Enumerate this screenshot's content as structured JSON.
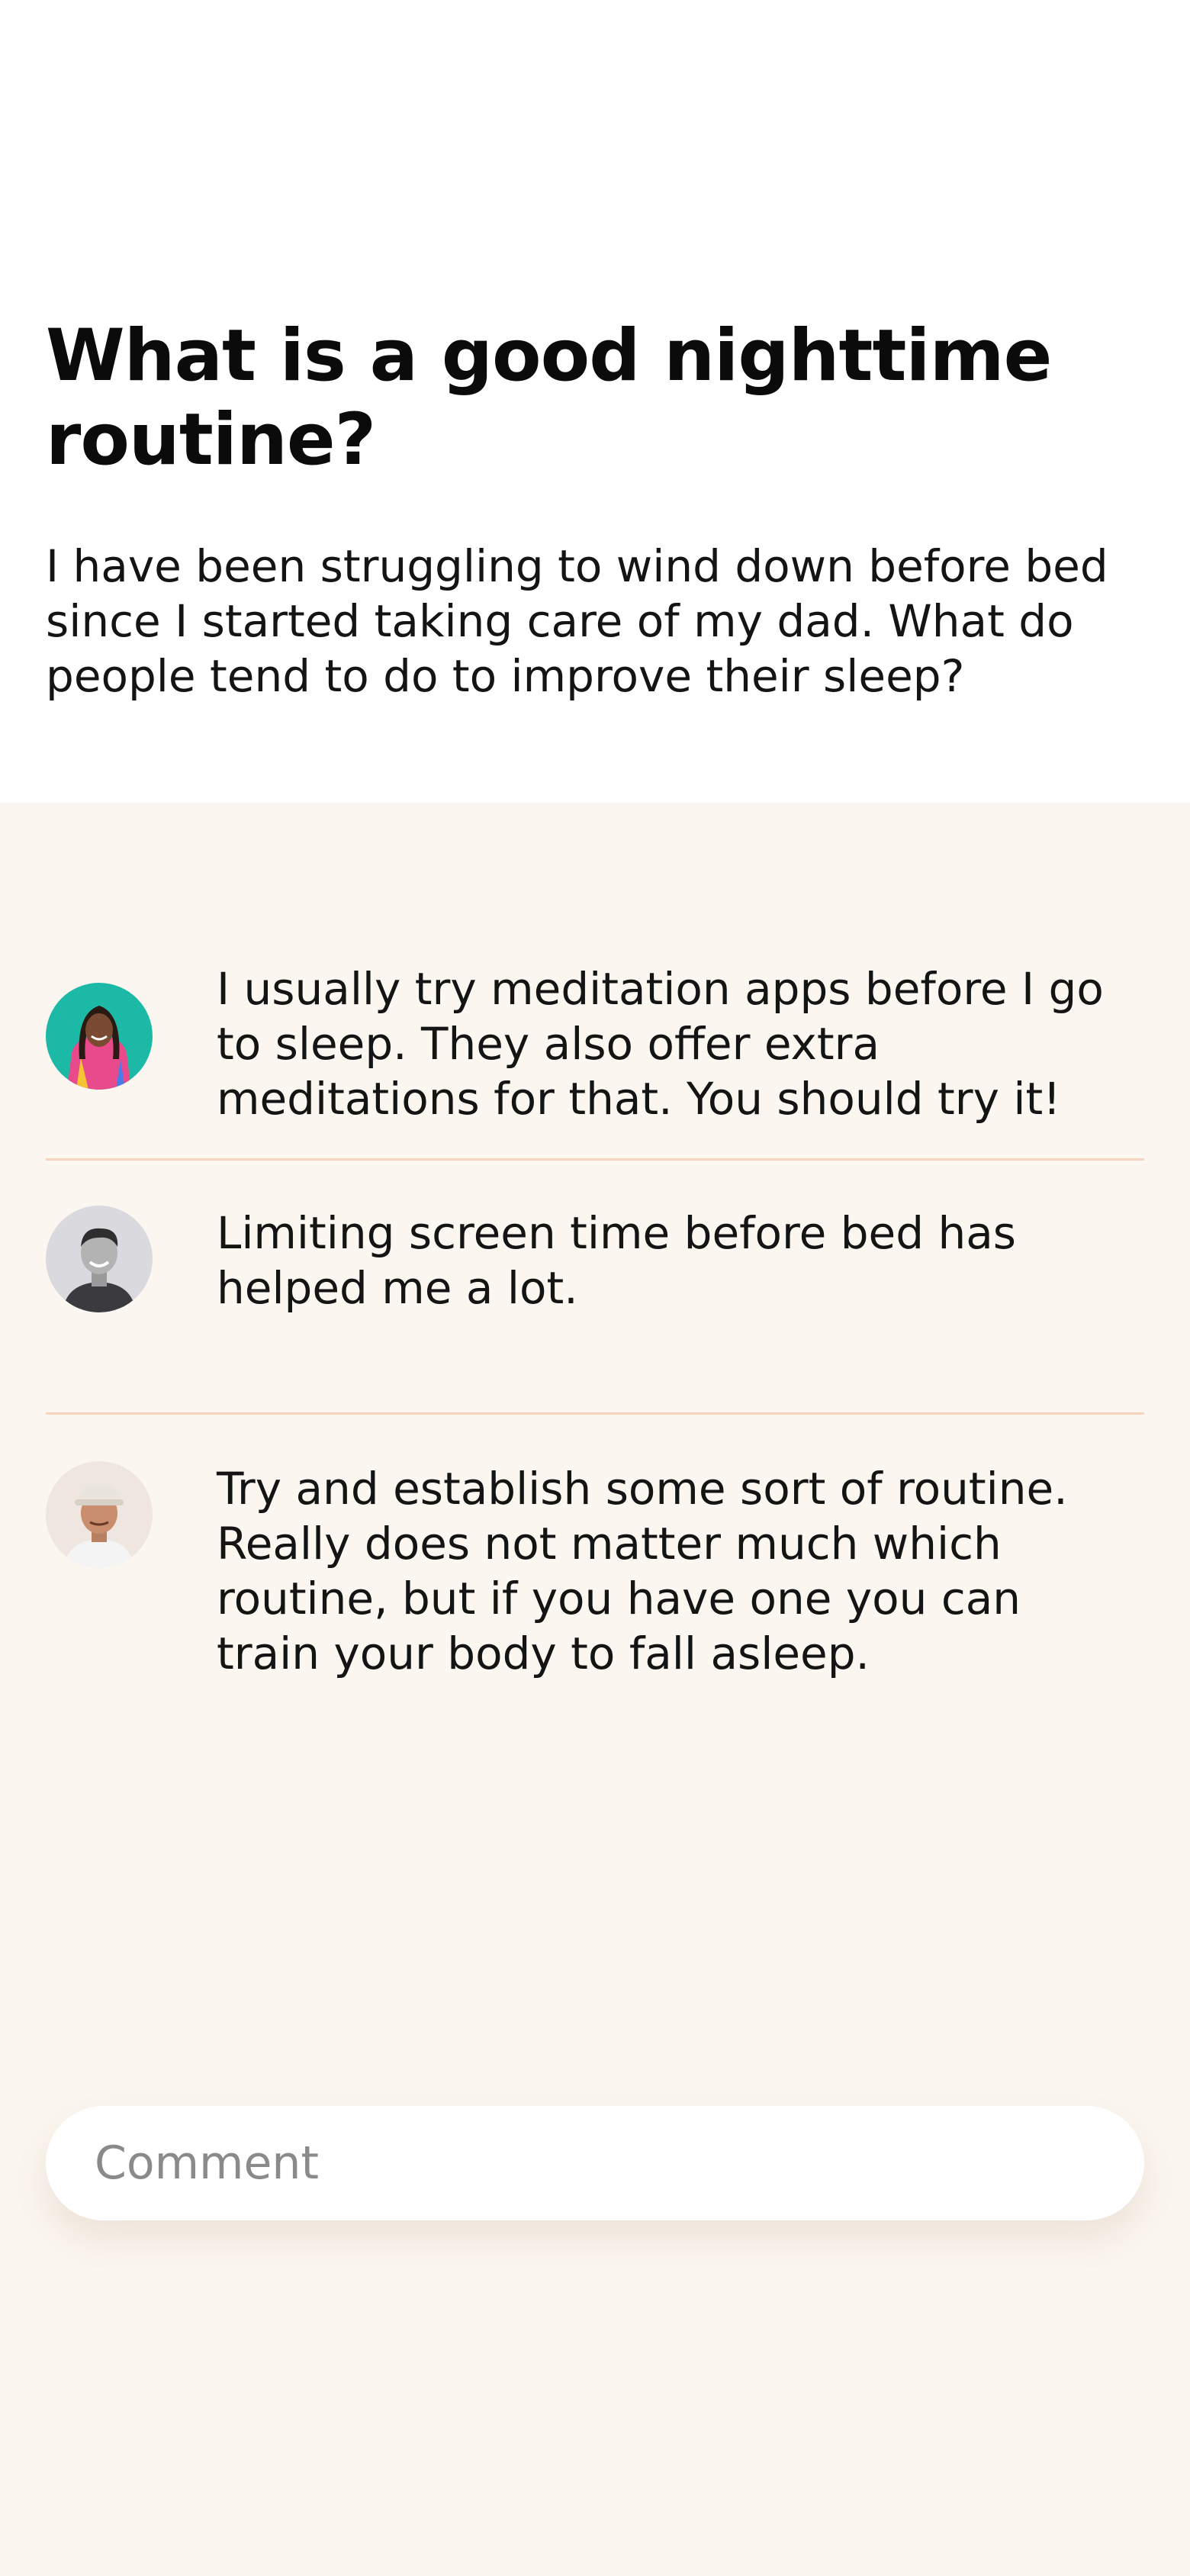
{
  "post": {
    "title": "What is a good nighttime routine?",
    "body": "I have been struggling to wind down before bed since I started taking care of my dad. What do people tend to do to improve their sleep?"
  },
  "comments": [
    {
      "text": "I usually try meditation apps before I go to sleep. They also offer extra meditations for that. You should try it!",
      "avatar_bg": "#1bb9a6"
    },
    {
      "text": "Limiting screen time before bed has helped me a lot.",
      "avatar_bg": "#d9d9de"
    },
    {
      "text": "Try and establish some sort of routine. Really does not matter much which routine, but if you have one you can train your body to fall asleep.",
      "avatar_bg": "#efe6e0"
    }
  ],
  "composer": {
    "placeholder": "Comment"
  },
  "colors": {
    "page_bg": "#ffffff",
    "thread_bg": "#fbf6f0",
    "divider": "#f6d4bf",
    "text": "#141414",
    "placeholder": "#8a8a8a"
  }
}
